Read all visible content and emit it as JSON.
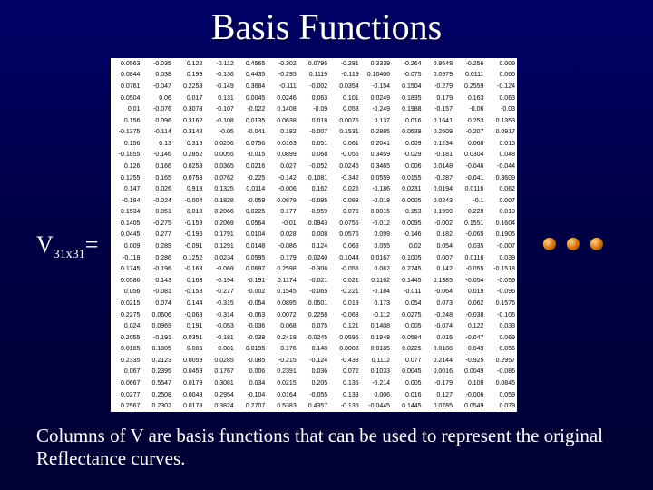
{
  "title": "Basis Functions",
  "label_main": "V",
  "label_sub": "31x31",
  "label_eq": "=",
  "caption": "Columns of V are basis functions that can be used to represent the original Reflectance curves.",
  "matrix": {
    "rows": 31,
    "cols": 13,
    "data": [
      [
        "0.0563",
        "-0.035",
        "0.122",
        "-0.112",
        "0.4565",
        "-0.302",
        "0.0796",
        "-0.281",
        "0.3339",
        "-0.264",
        "0.9548",
        "-0.256",
        "0.009"
      ],
      [
        "0.0844",
        "0.038",
        "0.199",
        "-0.136",
        "0.4435",
        "-0.295",
        "0.1119",
        "-0.119",
        "0.10406",
        "-0.075",
        "0.0979",
        "0.0111",
        "0.065"
      ],
      [
        "0.0761",
        "-0.047",
        "0.2253",
        "-0.149",
        "0.3684",
        "-0.111",
        "-0.002",
        "0.0354",
        "-0.154",
        "0.1504",
        "-0.279",
        "0.2559",
        "-0.124"
      ],
      [
        "0.0504",
        "0.06",
        "0.017",
        "0.131",
        "0.0045",
        "0.0246",
        "0.063",
        "0.101",
        "0.0249",
        "0.1835",
        "0.179",
        "0.163",
        "0.063"
      ],
      [
        "0.01",
        "-0.076",
        "0.3078",
        "-0.107",
        "-0.022",
        "0.1408",
        "-0.09",
        "0.053",
        "-0.249",
        "0.1988",
        "-0.157",
        "-0.06",
        "-0.03"
      ],
      [
        "0.156",
        "0.096",
        "0.3162",
        "-0.108",
        "0.0135",
        "0.0638",
        "0.018",
        "0.0075",
        "0.137",
        "0.016",
        "0.1641",
        "0.253",
        "0.1353"
      ],
      [
        "-0.1375",
        "-0.114",
        "0.3148",
        "-0.05",
        "-0.041",
        "0.182",
        "-0.007",
        "0.1531",
        "0.2885",
        "0.0539",
        "0.2509",
        "-0.207",
        "0.0917"
      ],
      [
        "0.156",
        "0.13",
        "0.319",
        "0.0256",
        "0.0756",
        "0.0163",
        "0.051",
        "0.061",
        "0.2041",
        "0.009",
        "0.1234",
        "0.068",
        "0.015"
      ],
      [
        "-0.1855",
        "-0.146",
        "0.2852",
        "0.0055",
        "-0.015",
        "0.0899",
        "0.068",
        "-0.055",
        "0.3459",
        "-0.029",
        "-0.181",
        "0.0304",
        "0.048"
      ],
      [
        "0.126",
        "0.166",
        "0.0253",
        "0.0365",
        "0.0216",
        "0.027",
        "-0.052",
        "0.0246",
        "0.3465",
        "0.006",
        "0.0148",
        "-0.046",
        "-0.044"
      ],
      [
        "0.1255",
        "0.165",
        "0.0758",
        "0.0762",
        "-0.225",
        "-0.142",
        "0.1081",
        "-0.342",
        "0.0559",
        "0.0155",
        "-0.287",
        "-0.041",
        "0.3609"
      ],
      [
        "0.147",
        "0.026",
        "0.918",
        "0.1325",
        "0.0114",
        "-0.006",
        "0.162",
        "0.026",
        "-0.186",
        "0.0231",
        "0.0194",
        "0.0116",
        "0.062"
      ],
      [
        "-0.184",
        "-0.024",
        "-0.004",
        "0.1828",
        "-0.059",
        "0.0878",
        "-0.095",
        "0.088",
        "-0.018",
        "0.0005",
        "0.0243",
        "-0.1",
        "0.007"
      ],
      [
        "0.1534",
        "0.051",
        "0.018",
        "0.2066",
        "0.0225",
        "0.177",
        "-0.959",
        "0.079",
        "0.0015",
        "0.153",
        "0.1999",
        "0.228",
        "0.019"
      ],
      [
        "0.1405",
        "-0.275",
        "-0.159",
        "0.2069",
        "0.0564",
        "-0.01",
        "0.0943",
        "0.0755",
        "-0.012",
        "0.0095",
        "-0.002",
        "0.1551",
        "0.1604"
      ],
      [
        "0.0445",
        "0.277",
        "-0.195",
        "0.1791",
        "0.0104",
        "0.028",
        "0.008",
        "0.0576",
        "0.099",
        "-0.146",
        "0.182",
        "-0.065",
        "0.1905"
      ],
      [
        "0.009",
        "0.289",
        "-0.091",
        "0.1291",
        "0.0148",
        "-0.086",
        "0.124",
        "0.063",
        "0.055",
        "0.02",
        "0.054",
        "0.035",
        "-0.007"
      ],
      [
        "-0.118",
        "0.286",
        "0.1252",
        "0.0234",
        "0.0595",
        "0.179",
        "0.0240",
        "0.1044",
        "0.0167",
        "0.1005",
        "0.007",
        "0.0116",
        "0.039"
      ],
      [
        "0.1745",
        "-0.196",
        "-0.163",
        "-0.069",
        "0.0697",
        "0.2598",
        "-0.306",
        "-0.055",
        "0.062",
        "0.2745",
        "0.142",
        "-0.055",
        "-0.1518"
      ],
      [
        "0.0586",
        "0.143",
        "0.163",
        "-0.194",
        "-0.191",
        "0.1174",
        "-0.021",
        "0.021",
        "0.1162",
        "0.1445",
        "0.1385",
        "-0.054",
        "-0.059"
      ],
      [
        "0.056",
        "-0.081",
        "-0.158",
        "-0.277",
        "-0.002",
        "0.1545",
        "-0.065",
        "-0.221",
        "-0.184",
        "-0.011",
        "-0.064",
        "0.019",
        "-0.096"
      ],
      [
        "0.0215",
        "0.074",
        "0.144",
        "-0.315",
        "-0.054",
        "0.0895",
        "0.0501",
        "0.019",
        "0.173",
        "0.054",
        "0.073",
        "0.062",
        "0.1576"
      ],
      [
        "0.2275",
        "0.0606",
        "-0.068",
        "-0.314",
        "-0.063",
        "0.0072",
        "0.2258",
        "-0.068",
        "-0.112",
        "0.0275",
        "-0.248",
        "-0.038",
        "-0.106"
      ],
      [
        "0.024",
        "0.0969",
        "0.191",
        "-0.053",
        "-0.036",
        "0.068",
        "0.075",
        "0.121",
        "0.1408",
        "0.005",
        "-0.074",
        "0.122",
        "0.033"
      ],
      [
        "0.2055",
        "-0.191",
        "0.0351",
        "-0.181",
        "-0.038",
        "0.2418",
        "0.0245",
        "0.0596",
        "0.1948",
        "0.0584",
        "0.015",
        "-0.047",
        "0.069"
      ],
      [
        "0.0185",
        "0.1805",
        "0.005",
        "-0.081",
        "0.0195",
        "0.176",
        "0.148",
        "0.0083",
        "0.0185",
        "0.0225",
        "0.0188",
        "-0.049",
        "-0.056"
      ],
      [
        "0.2335",
        "0.2123",
        "0.0059",
        "0.0285",
        "-0.085",
        "-0.215",
        "-0.124",
        "-0.433",
        "0.1112",
        "0.077",
        "0.2144",
        "-0.925",
        "0.2957"
      ],
      [
        "0.067",
        "0.2395",
        "0.0459",
        "0.1767",
        "0.006",
        "0.2391",
        "0.036",
        "0.072",
        "0.1033",
        "0.0045",
        "0.0016",
        "0.0049",
        "-0.086"
      ],
      [
        "0.0667",
        "0.5547",
        "0.0179",
        "0.3081",
        "0.034",
        "0.0215",
        "0.205",
        "0.135",
        "-0.214",
        "0.005",
        "-0.179",
        "0.108",
        "0.0845"
      ],
      [
        "0.0277",
        "0.2508",
        "0.0048",
        "0.2954",
        "-0.104",
        "0.0164",
        "-0.055",
        "0.133",
        "0.006",
        "0.016",
        "0.127",
        "-0.006",
        "0.059"
      ],
      [
        "0.2567",
        "0.2302",
        "0.0178",
        "0.3824",
        "0.2707",
        "0.5383",
        "0.4357",
        "-0.135",
        "-0.0445",
        "0.1445",
        "0.0785",
        "0.0549",
        "0.079"
      ]
    ]
  }
}
